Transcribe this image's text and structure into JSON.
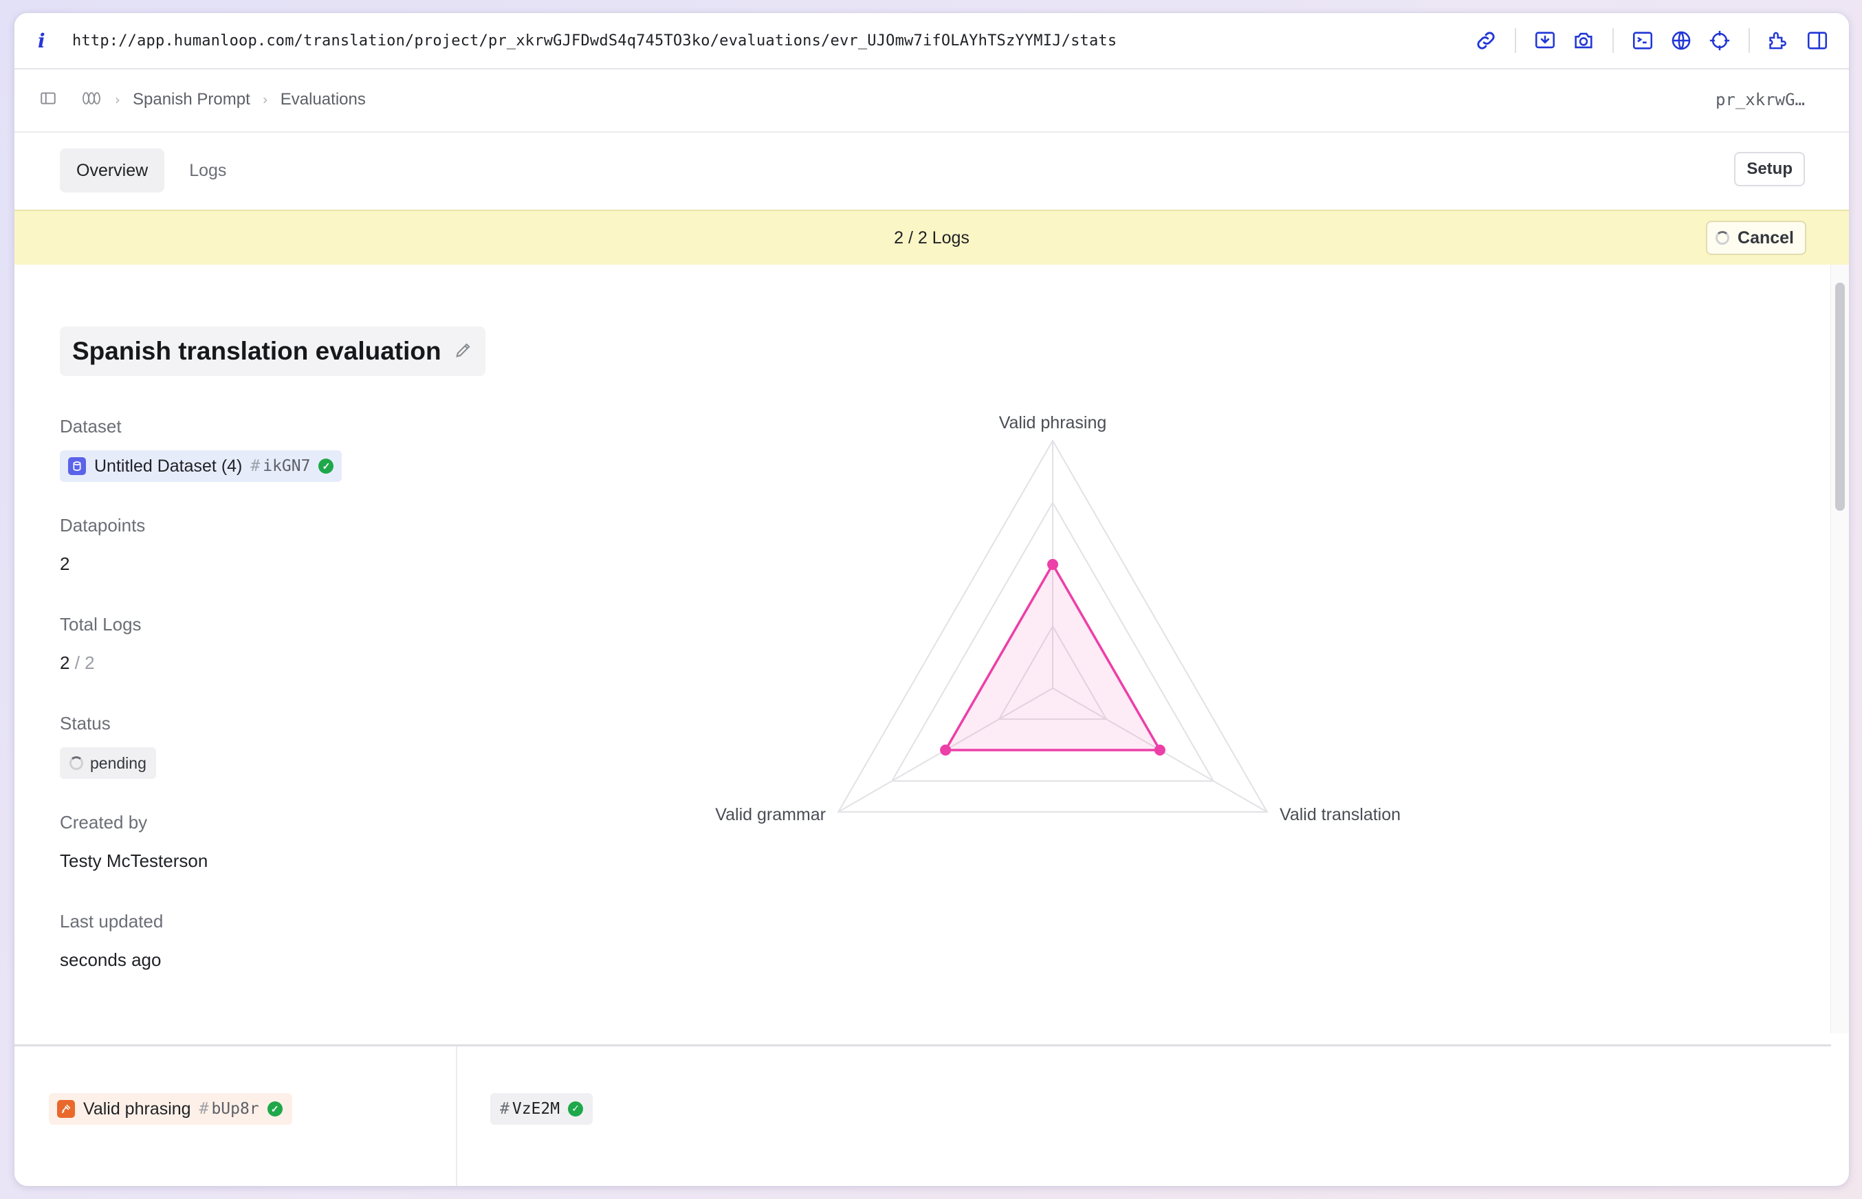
{
  "browser": {
    "url": "http://app.humanloop.com/translation/project/pr_xkrwGJFDwdS4q745TO3ko/evaluations/evr_UJOmw7ifOLAYhTSzYYMIJ/stats",
    "icons": [
      "info-icon",
      "link-icon",
      "screen-capture-icon",
      "camera-icon",
      "terminal-icon",
      "globe-icon",
      "crosshair-icon",
      "extension-icon",
      "split-view-icon"
    ]
  },
  "breadcrumb": {
    "project": "Spanish Prompt",
    "section": "Evaluations",
    "project_id": "pr_xkrwG…"
  },
  "tabs": [
    {
      "label": "Overview",
      "active": true
    },
    {
      "label": "Logs",
      "active": false
    }
  ],
  "setup_label": "Setup",
  "banner": {
    "progress": "2 / 2 Logs",
    "cancel_label": "Cancel",
    "color": "#fbf6c6"
  },
  "evaluation": {
    "title": "Spanish translation evaluation",
    "dataset_label": "Dataset",
    "dataset_name": "Untitled Dataset (4)",
    "dataset_hash": "ikGN7",
    "datapoints_label": "Datapoints",
    "datapoints_value": "2",
    "total_logs_label": "Total Logs",
    "total_logs_done": "2",
    "total_logs_sep": " / ",
    "total_logs_total": "2",
    "status_label": "Status",
    "status_value": "pending",
    "created_by_label": "Created by",
    "created_by_value": "Testy McTesterson",
    "last_updated_label": "Last updated",
    "last_updated_value": "seconds ago"
  },
  "chart_data": {
    "type": "radar",
    "axes": [
      "Valid phrasing",
      "Valid translation",
      "Valid grammar"
    ],
    "values": [
      0.5,
      0.5,
      0.5
    ],
    "range": [
      0,
      1
    ],
    "rings": 4,
    "series_color": "#ec3fa8"
  },
  "bottom": {
    "evaluator_name": "Valid phrasing",
    "evaluator_hash": "bUp8r",
    "version_hash": "VzE2M"
  }
}
